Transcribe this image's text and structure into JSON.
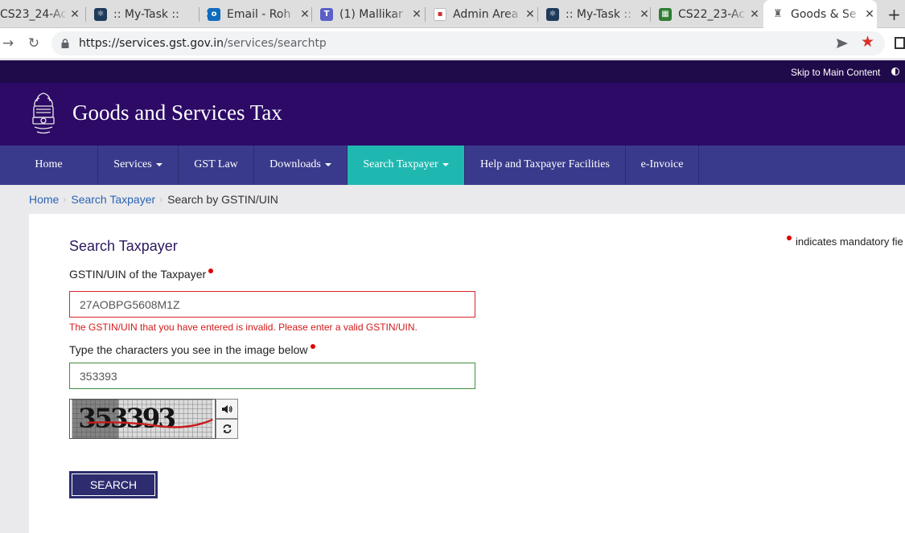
{
  "browser": {
    "tabs": [
      {
        "title": "CS23_24-Ac",
        "favicon": "spreadsheet-icon"
      },
      {
        "title": ":: My-Task ::",
        "favicon": "react-icon"
      },
      {
        "title": "Email - Roh",
        "favicon": "outlook-icon"
      },
      {
        "title": "(1) Mallikar",
        "favicon": "teams-icon"
      },
      {
        "title": "Admin Area",
        "favicon": "admin-icon"
      },
      {
        "title": ":: My-Task ::",
        "favicon": "react-icon"
      },
      {
        "title": "CS22_23-Ac",
        "favicon": "spreadsheet-icon"
      },
      {
        "title": "Goods & Se",
        "favicon": "emblem-icon"
      }
    ],
    "url_host": "https://services.gst.gov.in",
    "url_path": "/services/searchtp"
  },
  "site": {
    "skip_link": "Skip to Main Content",
    "title": "Goods and Services Tax"
  },
  "nav": {
    "items": [
      {
        "label": "Home"
      },
      {
        "label": "Services"
      },
      {
        "label": "GST Law"
      },
      {
        "label": "Downloads"
      },
      {
        "label": "Search Taxpayer"
      },
      {
        "label": "Help and Taxpayer Facilities"
      },
      {
        "label": "e-Invoice"
      }
    ]
  },
  "breadcrumb": {
    "items": [
      "Home",
      "Search Taxpayer",
      "Search by GSTIN/UIN"
    ]
  },
  "form": {
    "title": "Search Taxpayer",
    "mandatory_note": "indicates mandatory fie",
    "gstin_label": "GSTIN/UIN of the Taxpayer",
    "gstin_value": "27AOBPG5608M1Z",
    "gstin_error": "The GSTIN/UIN that you have entered is invalid. Please enter a valid GSTIN/UIN.",
    "captcha_label": "Type the characters you see in the image below",
    "captcha_value": "353393",
    "captcha_image_text": "353393",
    "search_button": "SEARCH"
  },
  "colors": {
    "header": "#2c0a66",
    "nav": "#3a3a8c",
    "nav_active": "#1fb8b0",
    "error": "#d11a1a",
    "valid": "#3f8f40"
  }
}
